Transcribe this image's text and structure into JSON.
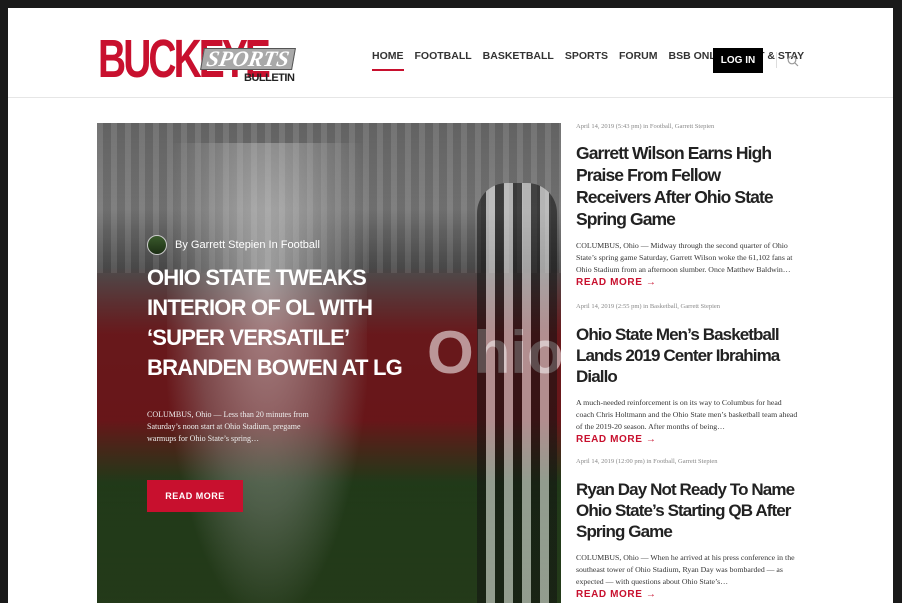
{
  "brand": {
    "logo_big": "BUCKEYE",
    "logo_sports": "SPORTS",
    "logo_bulletin": "BULLETIN"
  },
  "nav": {
    "items": [
      "HOME",
      "FOOTBALL",
      "BASKETBALL",
      "SPORTS",
      "FORUM",
      "BSB ONLINE",
      "EAT & STAY"
    ],
    "active": "HOME",
    "login": "LOG IN",
    "search_icon": "search-icon"
  },
  "hero": {
    "byline": "By Garrett Stepien In Football",
    "title": "OHIO STATE TWEAKS INTERIOR OF OL WITH ‘SUPER VERSATILE’ BRANDEN BOWEN AT LG",
    "excerpt": "COLUMBUS, Ohio — Less than 20 minutes from Saturday’s noon start at Ohio Stadium, pregame warmups for Ohio State’s spring…",
    "button": "READ MORE",
    "wall_text": "Ohio"
  },
  "articles": [
    {
      "meta": "April 14, 2019 (5:43 pm) in Football, Garrett Stepien",
      "title": "Garrett Wilson Earns High Praise From Fellow Receivers After Ohio State Spring Game",
      "excerpt": "COLUMBUS, Ohio — Midway through the second quarter of Ohio State’s spring game Saturday, Garrett Wilson woke the 61,102 fans at Ohio Stadium from an afternoon slumber. Once Matthew Baldwin…",
      "read_more": "READ MORE →"
    },
    {
      "meta": "April 14, 2019 (2:55 pm) in Basketball, Garrett Stepien",
      "title": "Ohio State Men’s Basketball Lands 2019 Center Ibrahima Diallo",
      "excerpt": "A much-needed reinforcement is on its way to Columbus for head coach Chris Holtmann and the Ohio State men’s basketball team ahead of the 2019-20 season. After months of being…",
      "read_more": "READ MORE →"
    },
    {
      "meta": "April 14, 2019 (12:00 pm) in Football, Garrett Stepien",
      "title": "Ryan Day Not Ready To Name Ohio State’s Starting QB After Spring Game",
      "excerpt": "COLUMBUS, Ohio — When he arrived at his press conference in the southeast tower of Ohio Stadium, Ryan Day was bombarded — as expected — with questions about Ohio State’s…",
      "read_more": "READ MORE →"
    }
  ],
  "colors": {
    "accent": "#c8102e",
    "login_bg": "#000000"
  }
}
